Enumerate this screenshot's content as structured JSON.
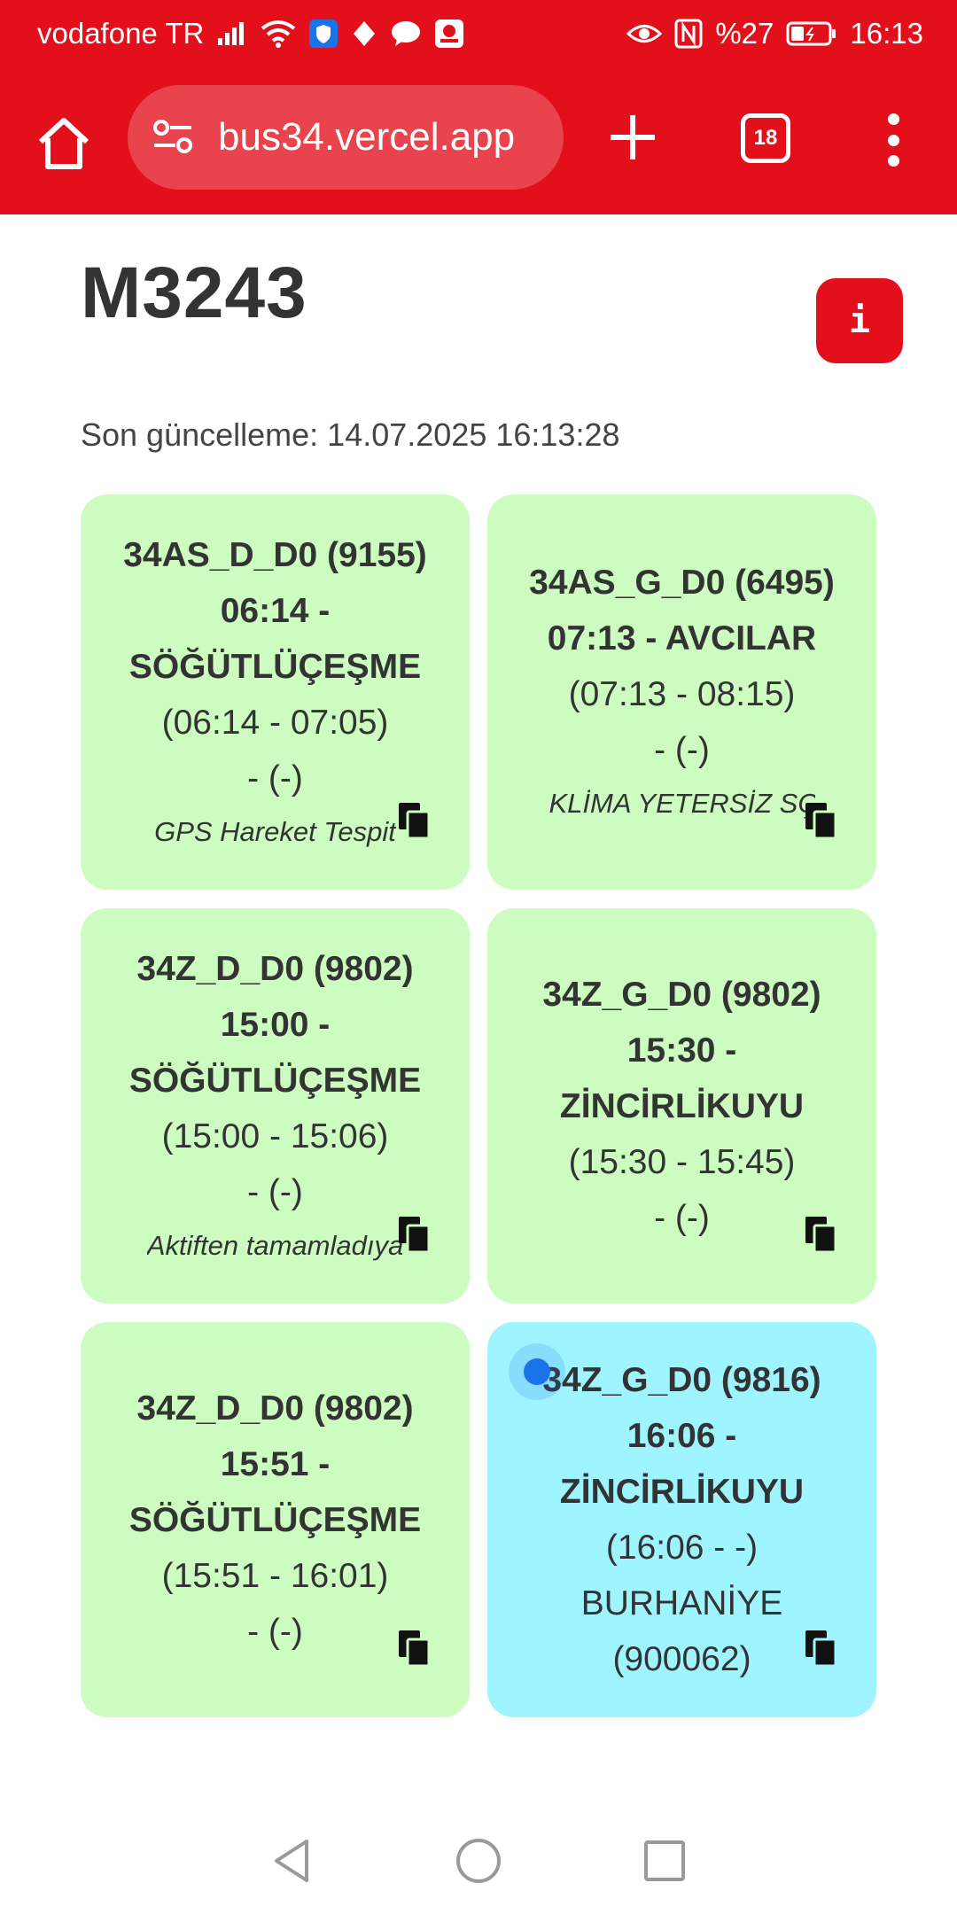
{
  "status_bar": {
    "carrier": "vodafone TR",
    "battery": "%27",
    "time": "16:13"
  },
  "browser": {
    "url": "bus34.vercel.app",
    "tab_count": "18"
  },
  "page": {
    "title": "M3243",
    "info_label": "i",
    "last_updated": "Son güncelleme: 14.07.2025 16:13:28"
  },
  "cards": [
    {
      "route": "34AS_D_D0 (9155)",
      "depart": "06:14 -",
      "dest": "SÖĞÜTLÜÇEŞME",
      "times": "(06:14 - 07:05)",
      "extra": "- (-)",
      "note": "GPS Hareket Tespit",
      "active": false
    },
    {
      "route": "34AS_G_D0 (6495)",
      "depart": "07:13 - AVCILAR",
      "dest": "",
      "times": "(07:13 - 08:15)",
      "extra": "- (-)",
      "note": "KLİMA YETERSİZ SÇM",
      "active": false
    },
    {
      "route": "34Z_D_D0 (9802)",
      "depart": "15:00 -",
      "dest": "SÖĞÜTLÜÇEŞME",
      "times": "(15:00 - 15:06)",
      "extra": "- (-)",
      "note": "Aktiften tamamladıya",
      "active": false
    },
    {
      "route": "34Z_G_D0 (9802)",
      "depart": "15:30 -",
      "dest": "ZİNCİRLİKUYU",
      "times": "(15:30 - 15:45)",
      "extra": "- (-)",
      "note": "",
      "active": false
    },
    {
      "route": "34Z_D_D0 (9802)",
      "depart": "15:51 -",
      "dest": "SÖĞÜTLÜÇEŞME",
      "times": "(15:51 - 16:01)",
      "extra": "- (-)",
      "note": "",
      "active": false
    },
    {
      "route": "34Z_G_D0 (9816)",
      "depart": "16:06 -",
      "dest": "ZİNCİRLİKUYU",
      "times": "(16:06 - -)",
      "extra": "BURHANİYE",
      "extra2": "(900062)",
      "note": "",
      "active": true
    }
  ],
  "colors": {
    "brand_red": "#e3101c",
    "card_green": "#ccfcc0",
    "card_active": "#9ff5ff"
  }
}
